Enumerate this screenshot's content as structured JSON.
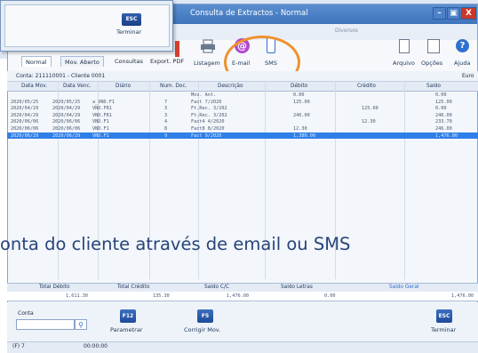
{
  "window": {
    "title": "Consulta de Extractos - Normal",
    "subtitle": "Diversos",
    "min": "–",
    "max": "▣",
    "close": "X"
  },
  "popup": {
    "esc": "ESC",
    "label": "Terminar"
  },
  "toolbar": {
    "tabs": [
      "Normal",
      "Mov. Aberto",
      "Consultas",
      "Export. PDF"
    ],
    "listagem": "Listagem",
    "email": "E-mail",
    "sms": "SMS",
    "arquivo": "Arquivo",
    "opcoes": "Opções",
    "ajuda": "Ajuda"
  },
  "account": {
    "label": "Conta: 211110001 - Cliente 0001",
    "currency": "Euro"
  },
  "table": {
    "headers": [
      "Data Mov.",
      "Data Venc.",
      "Diário",
      "Num. Doc.",
      "Descrição",
      "Débito",
      "Crédito",
      "Saldo"
    ],
    "rows": [
      [
        "",
        "",
        "",
        "",
        "Mov. Ant.",
        "0.00",
        "",
        "0.00"
      ],
      [
        "2020/05/25",
        "2020/05/25",
        "a_VND.F1",
        "7",
        "Fact 7/2020",
        "125.00",
        "",
        "125.00"
      ],
      [
        "2020/04/29",
        "2020/04/29",
        "VND.FR1",
        "3",
        "Ft.Rec. 3/202",
        "",
        "125.00",
        "0.00"
      ],
      [
        "2020/04/29",
        "2020/04/29",
        "VND.FR1",
        "3",
        "Ft.Rec. 3/202",
        "246.00",
        "",
        "246.00"
      ],
      [
        "2020/06/06",
        "2020/06/06",
        "VND.F1",
        "4",
        "Fact4 4/2020",
        "",
        "12.30",
        "233.70"
      ],
      [
        "2020/06/06",
        "2020/06/06",
        "VND.F1",
        "8",
        "Fact8 8/2020",
        "12.30",
        "",
        "246.00"
      ],
      [
        "2020/06/29",
        "2020/06/29",
        "VND.F1",
        "9",
        "Fact 9/2020",
        "1,380.00",
        "",
        "1,476.00"
      ]
    ]
  },
  "caption": "onta do cliente através de email ou SMS",
  "totals": {
    "headers": [
      "Total Débito",
      "Total Crédito",
      "Saldo C/C",
      "Saldo Letras",
      "Saldo Geral"
    ],
    "values": [
      "1,611.30",
      "135.30",
      "1,476.00",
      "0.00",
      "1,476.00"
    ]
  },
  "bottom": {
    "conta_label": "Conta",
    "f12": "F12",
    "parametrar": "Parametrar",
    "f5": "F5",
    "corrigir": "Corrigir Mov.",
    "esc": "ESC",
    "terminar": "Terminar"
  },
  "status": {
    "left": "(F) 7",
    "time": "00:00:00"
  },
  "colors": {
    "accent": "#2f7fe8",
    "titlebar": "#3f73bb",
    "highlight_ring": "#f0912d",
    "email_icon": "#b04ad0"
  }
}
